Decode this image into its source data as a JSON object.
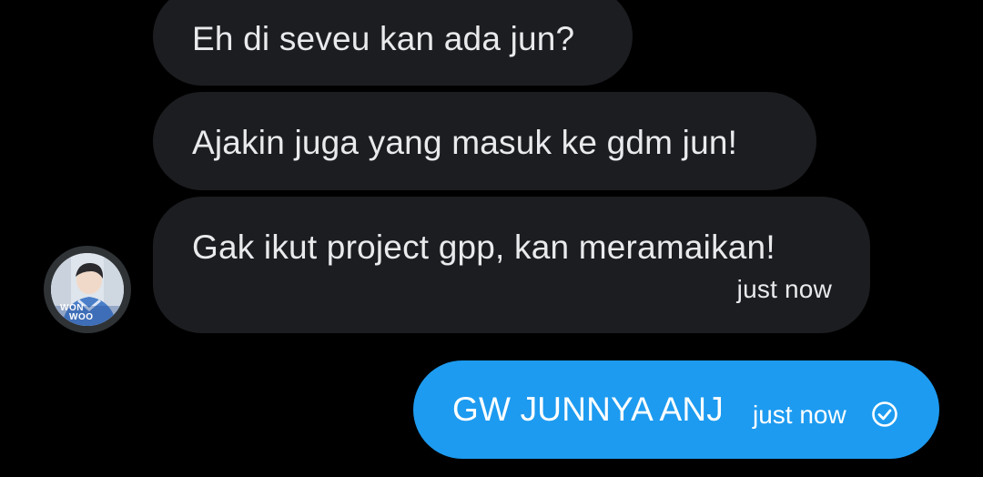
{
  "conversation": {
    "received_messages": [
      {
        "text": "Eh di seveu kan ada jun?"
      },
      {
        "text": "Ajakin juga yang masuk ke gdm jun!"
      },
      {
        "text": "Gak ikut project gpp, kan meramaikan!",
        "timestamp": "just now"
      }
    ],
    "sent_message": {
      "text": "GW JUNNYA ANJ",
      "timestamp": "just now",
      "status_icon": "check-circle-icon"
    },
    "avatar": {
      "icon": "avatar",
      "caption_lines": [
        "WON",
        "WOO"
      ]
    }
  },
  "colors": {
    "background": "#000000",
    "received_bubble": "#1c1d20",
    "sent_bubble": "#1d9bf0",
    "text": "#e9eaec"
  }
}
